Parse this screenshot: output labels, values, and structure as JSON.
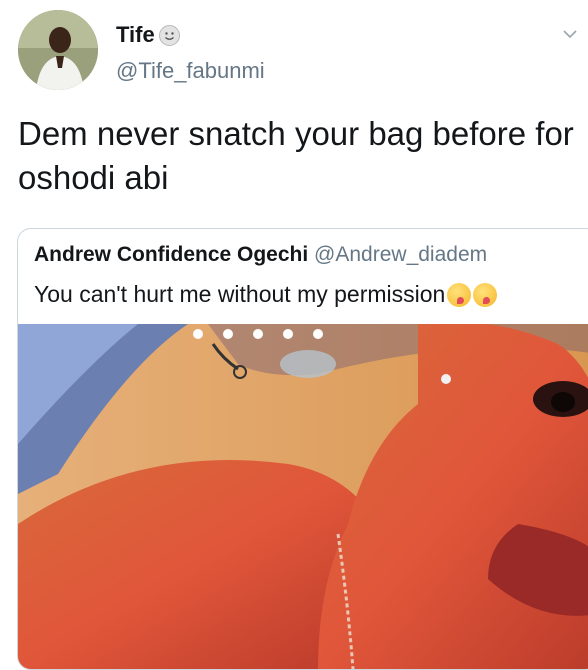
{
  "tweet": {
    "author_name": "Tife",
    "author_handle": "@Tife_fabunmi",
    "text": "Dem never snatch your bag before for oshodi abi"
  },
  "quote": {
    "author_name": "Andrew Confidence Ogechi",
    "author_handle": "@Andrew_diadem",
    "text": "You can't hurt me without my permission",
    "emojis": [
      "yum-emoji",
      "yum-emoji"
    ]
  },
  "icons": {
    "verified_like_emoji": "smiley-emoji",
    "menu": "chevron-down-icon"
  },
  "colors": {
    "text": "#14171a",
    "muted": "#657786",
    "border": "#ccd6dd"
  }
}
